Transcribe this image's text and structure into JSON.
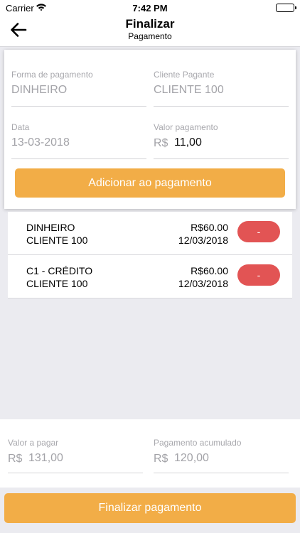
{
  "status_bar": {
    "carrier": "Carrier",
    "time": "7:42 PM"
  },
  "nav": {
    "title": "Finalizar",
    "subtitle": "Pagamento"
  },
  "form": {
    "payment_method": {
      "label": "Forma de pagamento",
      "value": "DINHEIRO"
    },
    "paying_client": {
      "label": "Cliente Pagante",
      "value": "CLIENTE 100"
    },
    "date": {
      "label": "Data",
      "value": "13-03-2018"
    },
    "amount": {
      "label": "Valor pagamento",
      "prefix": "R$",
      "value": "11,00"
    },
    "add_button": "Adicionar ao pagamento"
  },
  "payments": [
    {
      "method": "DINHEIRO",
      "client": "CLIENTE 100",
      "amount": "R$60.00",
      "date": "12/03/2018",
      "remove_label": "-"
    },
    {
      "method": "C1 - CRÉDITO",
      "client": "CLIENTE 100",
      "amount": "R$60.00",
      "date": "12/03/2018",
      "remove_label": "-"
    }
  ],
  "summary": {
    "to_pay": {
      "label": "Valor a pagar",
      "prefix": "R$",
      "value": "131,00"
    },
    "accumulated": {
      "label": "Pagamento acumulado",
      "prefix": "R$",
      "value": "120,00"
    }
  },
  "finalize_button": "Finalizar pagamento",
  "colors": {
    "accent": "#f2ad47",
    "remove": "#e25454",
    "background": "#ebebf0"
  }
}
